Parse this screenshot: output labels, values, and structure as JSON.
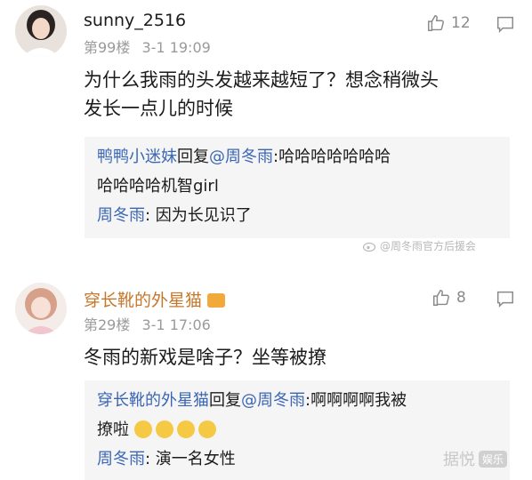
{
  "comments": [
    {
      "username": "sunny_2516",
      "floor": "第99楼",
      "time": "3-1 19:09",
      "likes": "12",
      "body": "为什么我雨的头发越来越短了？想念稍微头发长一点儿的时候",
      "body_line1": "为什么我雨的头发越来越短了？想念稍微头",
      "body_line2": "发长一点儿的时候",
      "replies": [
        {
          "author": "鸭鸭小迷妹",
          "connector": "回复",
          "target": "@周冬雨",
          "sep": ":",
          "text_line1": "哈哈哈哈哈哈哈",
          "text_line2": "哈哈哈哈机智girl"
        },
        {
          "author": "周冬雨",
          "sep": ": ",
          "text": "因为长见识了"
        }
      ]
    },
    {
      "username": "穿长靴的外星猫",
      "floor": "第29楼",
      "time": "3-1 17:06",
      "likes": "8",
      "body": "冬雨的新戏是啥子？坐等被撩",
      "replies": [
        {
          "author": "穿长靴的外星猫",
          "connector": "回复",
          "target": "@周冬雨",
          "sep": ":",
          "text_line1": "啊啊啊啊我被",
          "text_line2": "撩啦"
        },
        {
          "author": "周冬雨",
          "sep": ": ",
          "text": "演一名女性"
        }
      ]
    }
  ],
  "watermarks": {
    "weibo": "@周冬雨官方后援会",
    "site": "据悦",
    "site_badge": "娱乐"
  },
  "colors": {
    "link_blue": "#3a66b5",
    "reply_bg": "#f5f5f5",
    "meta_gray": "#9a9a9a"
  },
  "icons": [
    "thumbs-up-icon",
    "reply-bubble-icon",
    "crown-badge-icon",
    "crying-emoji-icon"
  ]
}
